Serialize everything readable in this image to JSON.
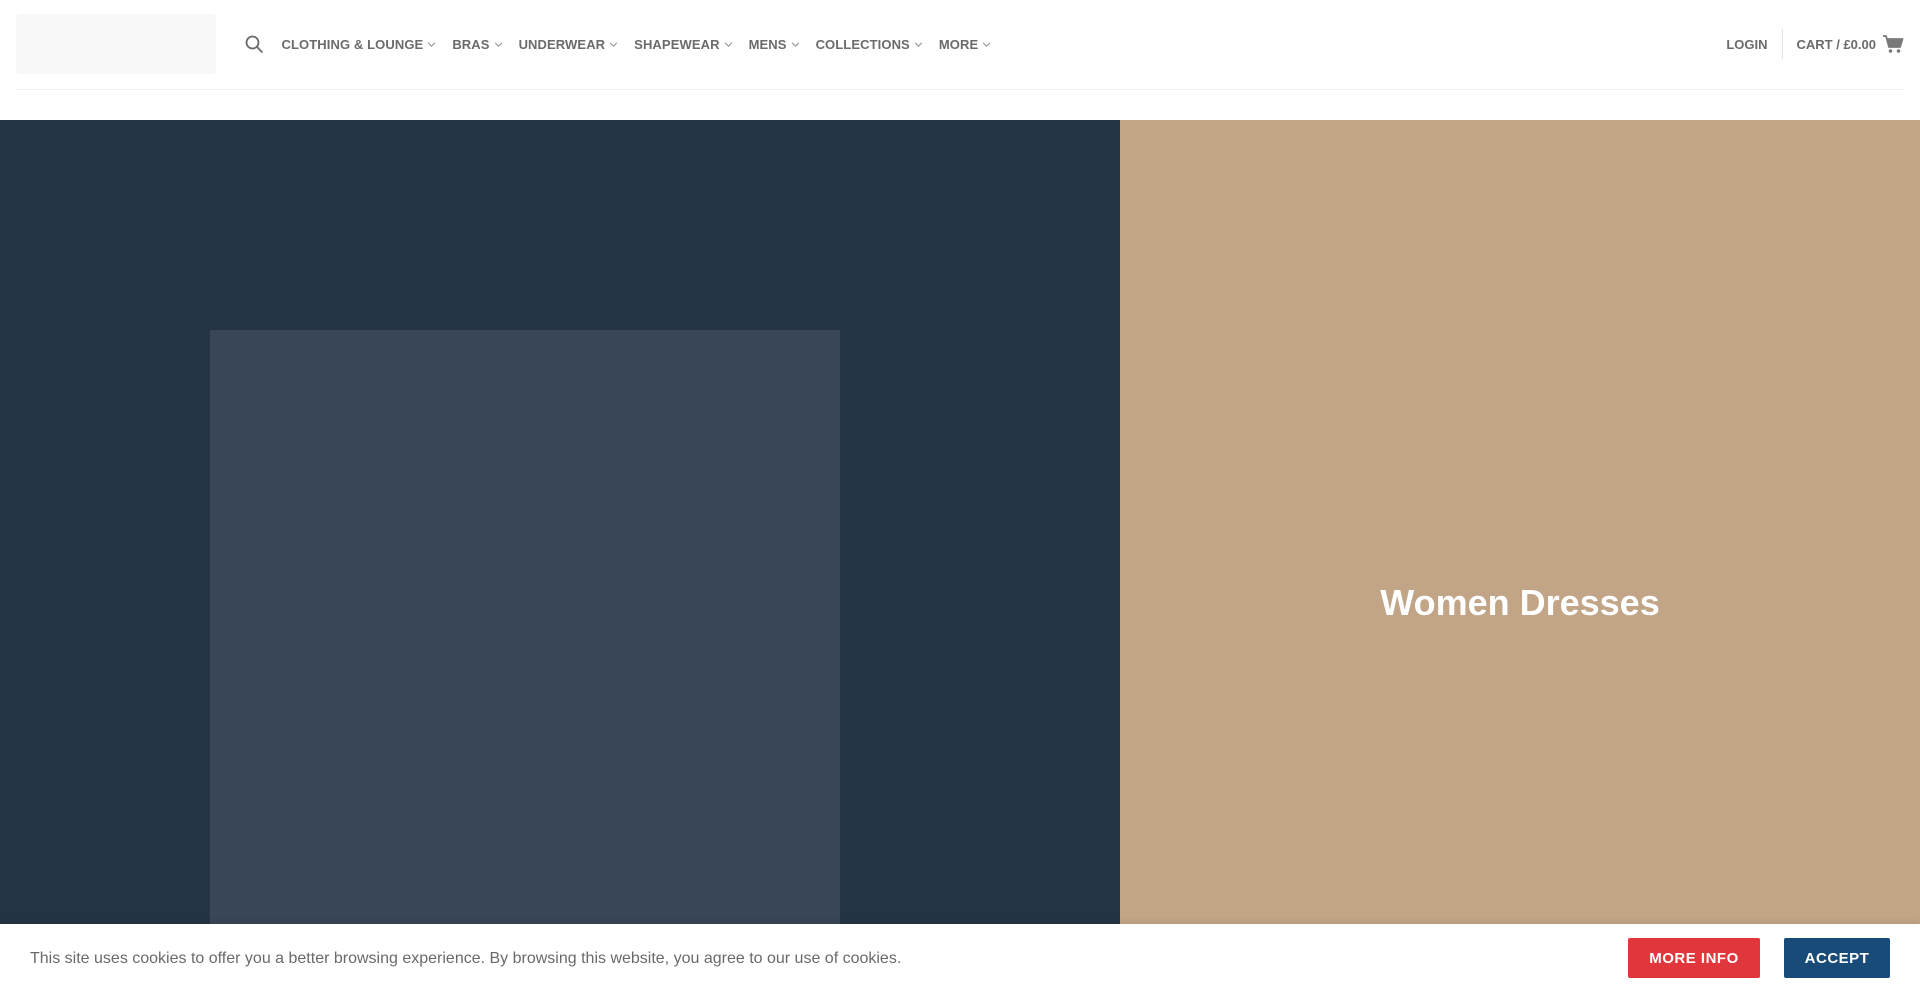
{
  "header": {
    "nav_items": [
      {
        "label": "CLOTHING & LOUNGE"
      },
      {
        "label": "BRAS"
      },
      {
        "label": "UNDERWEAR"
      },
      {
        "label": "SHAPEWEAR"
      },
      {
        "label": "MENS"
      },
      {
        "label": "COLLECTIONS"
      },
      {
        "label": "MORE"
      }
    ],
    "login_label": "LOGIN",
    "cart_label": "CART / £0.00",
    "icons": {
      "search": "search-icon",
      "cart": "cart-icon",
      "chevron": "chevron-down-icon"
    }
  },
  "hero": {
    "right_title": "Women Dresses",
    "colors": {
      "left_bg": "#253445",
      "left_inner": "#394657",
      "right_bg": "#c2a587"
    }
  },
  "cookie_bar": {
    "text": "This site uses cookies to offer you a better browsing experience. By browsing this website, you agree to our use of cookies.",
    "more_info_label": "MORE INFO",
    "accept_label": "ACCEPT",
    "colors": {
      "more_info": "#e1363b",
      "accept": "#184b78"
    }
  }
}
